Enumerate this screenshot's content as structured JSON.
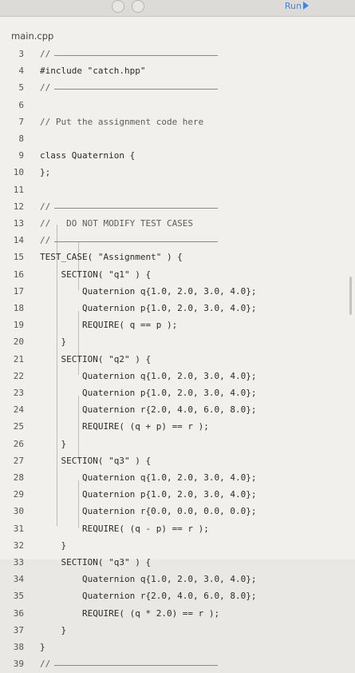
{
  "window": {
    "tab_title": "",
    "run_label": "Run"
  },
  "file_tab": "main.cpp",
  "lines": [
    {
      "num": "3",
      "text": "//",
      "kind": "comment"
    },
    {
      "num": "4",
      "text": "#include \"catch.hpp\"",
      "kind": "code"
    },
    {
      "num": "5",
      "text": "//",
      "kind": "comment"
    },
    {
      "num": "6",
      "text": "",
      "kind": "code"
    },
    {
      "num": "7",
      "text": "// Put the assignment code here",
      "kind": "comment"
    },
    {
      "num": "8",
      "text": "",
      "kind": "code"
    },
    {
      "num": "9",
      "text": "class Quaternion {",
      "kind": "code"
    },
    {
      "num": "10",
      "text": "};",
      "kind": "code"
    },
    {
      "num": "11",
      "text": "",
      "kind": "code"
    },
    {
      "num": "12",
      "text": "//",
      "kind": "comment"
    },
    {
      "num": "13",
      "text": "//   DO NOT MODIFY TEST CASES",
      "kind": "comment"
    },
    {
      "num": "14",
      "text": "//",
      "kind": "comment"
    },
    {
      "num": "15",
      "text": "TEST_CASE( \"Assignment\" ) {",
      "kind": "code"
    },
    {
      "num": "16",
      "text": "    SECTION( \"q1\" ) {",
      "kind": "code"
    },
    {
      "num": "17",
      "text": "        Quaternion q{1.0, 2.0, 3.0, 4.0};",
      "kind": "code"
    },
    {
      "num": "18",
      "text": "        Quaternion p{1.0, 2.0, 3.0, 4.0};",
      "kind": "code"
    },
    {
      "num": "19",
      "text": "        REQUIRE( q == p );",
      "kind": "code"
    },
    {
      "num": "20",
      "text": "    }",
      "kind": "code"
    },
    {
      "num": "21",
      "text": "    SECTION( \"q2\" ) {",
      "kind": "code"
    },
    {
      "num": "22",
      "text": "        Quaternion q{1.0, 2.0, 3.0, 4.0};",
      "kind": "code"
    },
    {
      "num": "23",
      "text": "        Quaternion p{1.0, 2.0, 3.0, 4.0};",
      "kind": "code"
    },
    {
      "num": "24",
      "text": "        Quaternion r{2.0, 4.0, 6.0, 8.0};",
      "kind": "code"
    },
    {
      "num": "25",
      "text": "        REQUIRE( (q + p) == r );",
      "kind": "code"
    },
    {
      "num": "26",
      "text": "    }",
      "kind": "code"
    },
    {
      "num": "27",
      "text": "    SECTION( \"q3\" ) {",
      "kind": "code"
    },
    {
      "num": "28",
      "text": "        Quaternion q{1.0, 2.0, 3.0, 4.0};",
      "kind": "code"
    },
    {
      "num": "29",
      "text": "        Quaternion p{1.0, 2.0, 3.0, 4.0};",
      "kind": "code"
    },
    {
      "num": "30",
      "text": "        Quaternion r{0.0, 0.0, 0.0, 0.0};",
      "kind": "code"
    },
    {
      "num": "31",
      "text": "        REQUIRE( (q - p) == r );",
      "kind": "code"
    },
    {
      "num": "32",
      "text": "    }",
      "kind": "code"
    },
    {
      "num": "33",
      "text": "    SECTION( \"q3\" ) {",
      "kind": "code"
    },
    {
      "num": "34",
      "text": "        Quaternion q{1.0, 2.0, 3.0, 4.0};",
      "kind": "code"
    },
    {
      "num": "35",
      "text": "        Quaternion r{2.0, 4.0, 6.0, 8.0};",
      "kind": "code"
    },
    {
      "num": "36",
      "text": "        REQUIRE( (q * 2.0) == r );",
      "kind": "code"
    },
    {
      "num": "37",
      "text": "    }",
      "kind": "code"
    },
    {
      "num": "38",
      "text": "}",
      "kind": "code"
    },
    {
      "num": "39",
      "text": "//",
      "kind": "comment"
    }
  ]
}
